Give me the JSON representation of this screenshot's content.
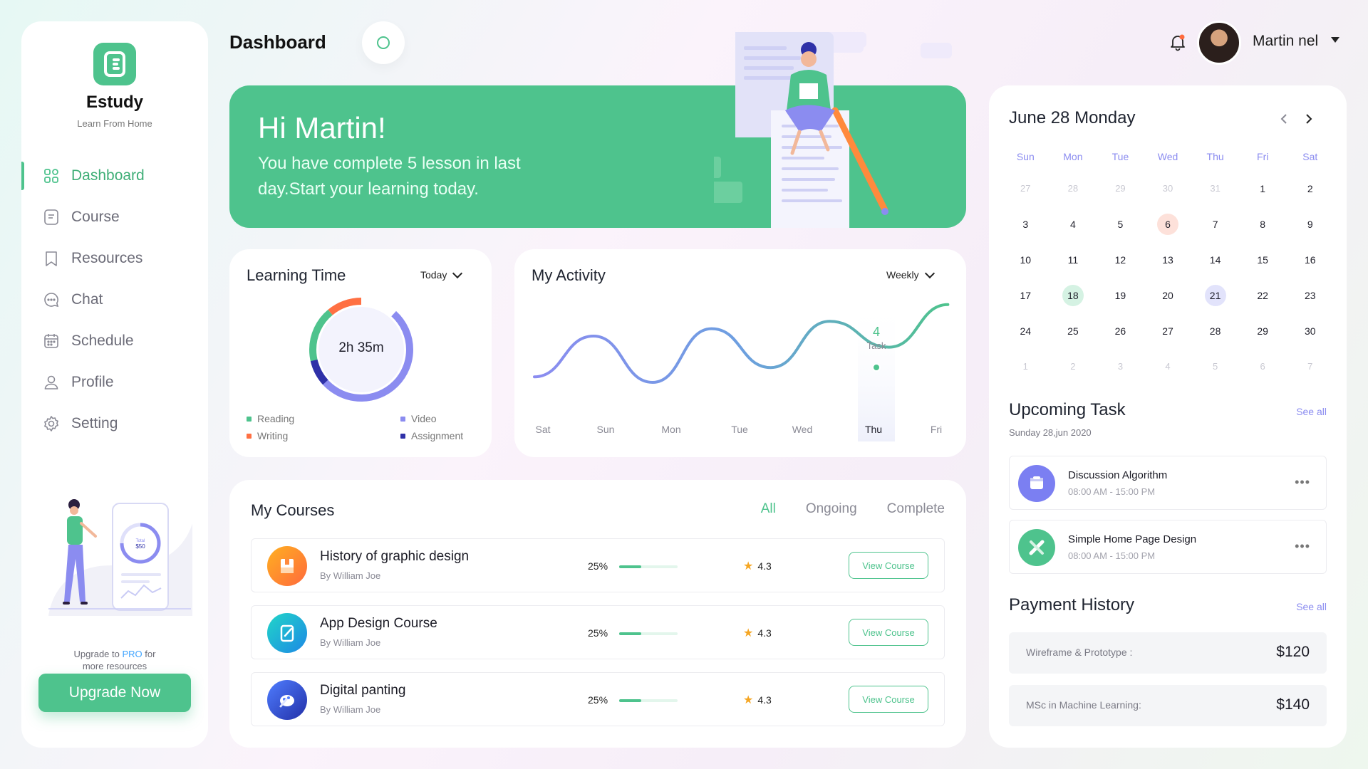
{
  "app": {
    "name": "Estudy",
    "tagline": "Learn From Home"
  },
  "nav": [
    {
      "label": "Dashboard",
      "icon": "dashboard-icon",
      "active": true
    },
    {
      "label": "Course",
      "icon": "course-icon"
    },
    {
      "label": "Resources",
      "icon": "bookmark-icon"
    },
    {
      "label": "Chat",
      "icon": "chat-icon"
    },
    {
      "label": "Schedule",
      "icon": "calendar-icon"
    },
    {
      "label": "Profile",
      "icon": "user-icon"
    },
    {
      "label": "Setting",
      "icon": "gear-icon"
    }
  ],
  "upgrade": {
    "prefix": "Upgrade  to ",
    "pro": "PRO",
    "suffix": " for",
    "line2": "more resources",
    "button": "Upgrade Now",
    "phone_top": "Total",
    "phone_amount": "$50"
  },
  "header": {
    "title": "Dashboard",
    "user_name": "Martin nel"
  },
  "hero": {
    "greeting": "Hi Martin!",
    "message": "You have complete 5 lesson in last day.Start your learning today."
  },
  "learning_time": {
    "title": "Learning Time",
    "filter": "Today",
    "center_label": "2h 35m",
    "legend": [
      {
        "label": "Reading",
        "color": "#4ec38d"
      },
      {
        "label": "Writing",
        "color": "#ff7043"
      },
      {
        "label": "Video",
        "color": "#8b8cf0"
      },
      {
        "label": "Assignment",
        "color": "#2f31a8"
      }
    ]
  },
  "activity": {
    "title": "My Activity",
    "filter": "Weekly",
    "highlight_value": "4",
    "highlight_label": "Task"
  },
  "chart_data": {
    "type": "line",
    "categories": [
      "Sat",
      "Sun",
      "Mon",
      "Tue",
      "Wed",
      "Thu",
      "Fri"
    ],
    "x": [
      0,
      0.95,
      1.9,
      2.85,
      3.8,
      4.75,
      5.7,
      6.65,
      7.6
    ],
    "values": [
      0.8,
      3.0,
      0.5,
      3.4,
      1.3,
      3.8,
      2.4,
      4.7
    ],
    "highlight": {
      "category": "Thu",
      "value": 4
    },
    "ylim": [
      0,
      5
    ],
    "title": "My Activity",
    "xlabel": "",
    "ylabel": "",
    "grid": false
  },
  "courses": {
    "title": "My Courses",
    "tabs": [
      {
        "label": "All",
        "active": true
      },
      {
        "label": "Ongoing"
      },
      {
        "label": "Complete"
      }
    ],
    "items": [
      {
        "name": "History of graphic design",
        "author": "By William Joe",
        "progress_label": "25%",
        "progress": 0.38,
        "rating": "4.3",
        "button": "View Course",
        "icon": "book-icon",
        "color_a": "#ffb020",
        "color_b": "#ff6a3d"
      },
      {
        "name": "App Design Course",
        "author": "By William Joe",
        "progress_label": "25%",
        "progress": 0.38,
        "rating": "4.3",
        "button": "View Course",
        "icon": "tablet-pen-icon",
        "color_a": "#20d6c8",
        "color_b": "#1e88e5"
      },
      {
        "name": "Digital panting",
        "author": "By William Joe",
        "progress_label": "25%",
        "progress": 0.38,
        "rating": "4.3",
        "button": "View Course",
        "icon": "paint-icon",
        "color_a": "#4f7dff",
        "color_b": "#2330a8"
      }
    ]
  },
  "calendar": {
    "title": "June 28 Monday",
    "weekdays": [
      "Sun",
      "Mon",
      "Tue",
      "Wed",
      "Thu",
      "Fri",
      "Sat"
    ],
    "weeks": [
      [
        "27",
        "28",
        "29",
        "30",
        "31",
        "1",
        "2"
      ],
      [
        "3",
        "4",
        "5",
        "6",
        "7",
        "8",
        "9"
      ],
      [
        "10",
        "11",
        "12",
        "13",
        "14",
        "15",
        "16"
      ],
      [
        "17",
        "18",
        "19",
        "20",
        "21",
        "22",
        "23"
      ],
      [
        "24",
        "25",
        "26",
        "27",
        "28",
        "29",
        "30"
      ],
      [
        "1",
        "2",
        "3",
        "4",
        "5",
        "6",
        "7"
      ]
    ],
    "muted_first_row_upto": 4,
    "muted_last_row": true,
    "marked": {
      "6": "mark-red",
      "18": "mark-green",
      "21": "mark-blue"
    }
  },
  "upcoming": {
    "title": "Upcoming Task",
    "see_all": "See all",
    "date": "Sunday 28,jun 2020",
    "tasks": [
      {
        "name": "Discussion Algorithm",
        "time": "08:00 AM - 15:00 PM",
        "icon": "discussion-icon",
        "color": "#7b7ff2"
      },
      {
        "name": "Simple Home Page Design",
        "time": "08:00 AM - 15:00 PM",
        "icon": "design-tool-icon",
        "color": "#4ec38d"
      }
    ]
  },
  "payments": {
    "title": "Payment History",
    "see_all": "See all",
    "items": [
      {
        "label": "Wireframe & Prototype :",
        "amount": "$120"
      },
      {
        "label": "MSc in Machine Learning:",
        "amount": "$140"
      }
    ]
  }
}
